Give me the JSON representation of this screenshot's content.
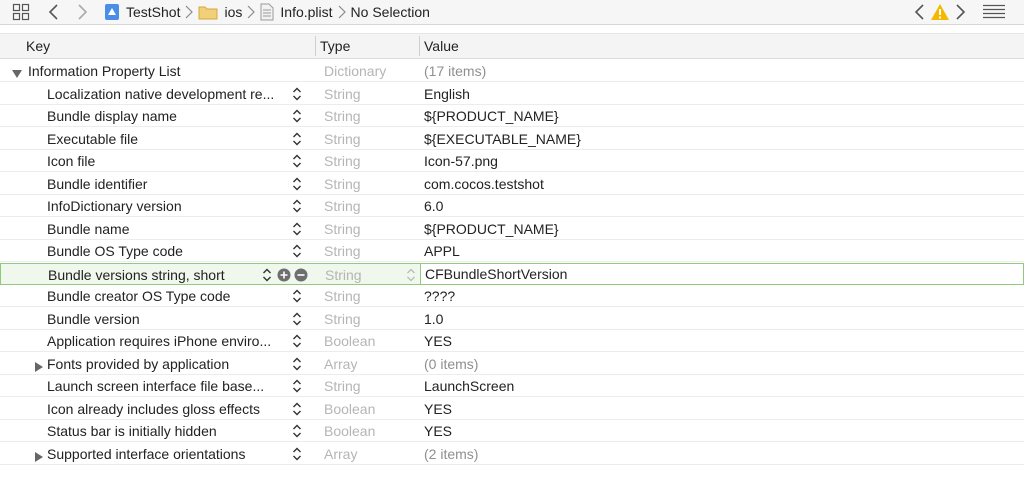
{
  "jumpbar": {
    "breadcrumbs": [
      {
        "label": "TestShot",
        "icon": "project-icon"
      },
      {
        "label": "ios",
        "icon": "folder-icon"
      },
      {
        "label": "Info.plist",
        "icon": "plist-file-icon"
      },
      {
        "label": "No Selection",
        "icon": ""
      }
    ],
    "accent_color": "#f5b800"
  },
  "columns": {
    "key": "Key",
    "type": "Type",
    "value": "Value"
  },
  "root": {
    "key": "Information Property List",
    "type": "Dictionary",
    "value": "(17 items)"
  },
  "rows": [
    {
      "key": "Localization native development re...",
      "type": "String",
      "value": "English"
    },
    {
      "key": "Bundle display name",
      "type": "String",
      "value": "${PRODUCT_NAME}"
    },
    {
      "key": "Executable file",
      "type": "String",
      "value": "${EXECUTABLE_NAME}"
    },
    {
      "key": "Icon file",
      "type": "String",
      "value": "Icon-57.png"
    },
    {
      "key": "Bundle identifier",
      "type": "String",
      "value": "com.cocos.testshot"
    },
    {
      "key": "InfoDictionary version",
      "type": "String",
      "value": "6.0"
    },
    {
      "key": "Bundle name",
      "type": "String",
      "value": "${PRODUCT_NAME}"
    },
    {
      "key": "Bundle OS Type code",
      "type": "String",
      "value": "APPL"
    },
    {
      "key": "Bundle versions string, short",
      "type": "String",
      "value": "CFBundleShortVersion",
      "selected": true
    },
    {
      "key": "Bundle creator OS Type code",
      "type": "String",
      "value": "????"
    },
    {
      "key": "Bundle version",
      "type": "String",
      "value": "1.0"
    },
    {
      "key": "Application requires iPhone enviro...",
      "type": "Boolean",
      "value": "YES"
    },
    {
      "key": "Fonts provided by application",
      "type": "Array",
      "value": "(0 items)",
      "expandable": true
    },
    {
      "key": "Launch screen interface file base...",
      "type": "String",
      "value": "LaunchScreen"
    },
    {
      "key": "Icon already includes gloss effects",
      "type": "Boolean",
      "value": "YES"
    },
    {
      "key": "Status bar is initially hidden",
      "type": "Boolean",
      "value": "YES"
    },
    {
      "key": "Supported interface orientations",
      "type": "Array",
      "value": "(2 items)",
      "expandable": true
    }
  ]
}
